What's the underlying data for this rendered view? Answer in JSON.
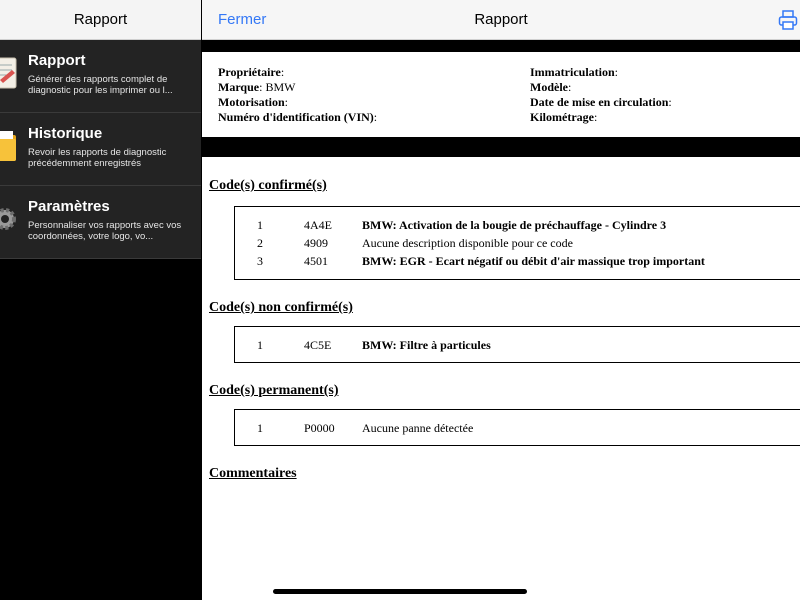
{
  "sidebar": {
    "title": "Rapport",
    "items": [
      {
        "icon": "report-document-icon",
        "title": "Rapport",
        "desc": "Générer des rapports complet de diagnostic pour les imprimer ou l..."
      },
      {
        "icon": "folder-icon",
        "title": "Historique",
        "desc": "Revoir les rapports de diagnostic précédemment enregistrés"
      },
      {
        "icon": "gear-icon",
        "title": "Paramètres",
        "desc": "Personnaliser vos rapports avec vos coordonnées, votre logo, vo..."
      }
    ]
  },
  "header": {
    "close_label": "Fermer",
    "title": "Rapport",
    "print_icon": "printer-icon"
  },
  "vehicle": {
    "owner_label": "Propriétaire",
    "brand_label": "Marque",
    "brand_value": "BMW",
    "engine_label": "Motorisation",
    "vin_label": "Numéro d'identification (VIN)",
    "plate_label": "Immatriculation",
    "model_label": "Modèle",
    "date_label": "Date de mise en circulation",
    "mileage_label": "Kilométrage"
  },
  "sections": {
    "confirmed": {
      "title": "Code(s) confirmé(s)",
      "rows": [
        {
          "num": "1",
          "code": "4A4E",
          "desc": "BMW: Activation de la bougie de préchauffage - Cylindre 3",
          "bold": true
        },
        {
          "num": "2",
          "code": "4909",
          "desc": "Aucune description disponible pour ce code",
          "bold": false
        },
        {
          "num": "3",
          "code": "4501",
          "desc": "BMW: EGR - Ecart négatif ou débit d'air massique trop important",
          "bold": true
        }
      ]
    },
    "unconfirmed": {
      "title": "Code(s) non confirmé(s)",
      "rows": [
        {
          "num": "1",
          "code": "4C5E",
          "desc": "BMW: Filtre à particules",
          "bold": true
        }
      ]
    },
    "permanent": {
      "title": "Code(s) permanent(s)",
      "rows": [
        {
          "num": "1",
          "code": "P0000",
          "desc": "Aucune panne détectée",
          "bold": false
        }
      ]
    },
    "comments": {
      "title": "Commentaires"
    }
  },
  "colors": {
    "accent": "#3478f6",
    "sidebar_bg": "#232323"
  }
}
